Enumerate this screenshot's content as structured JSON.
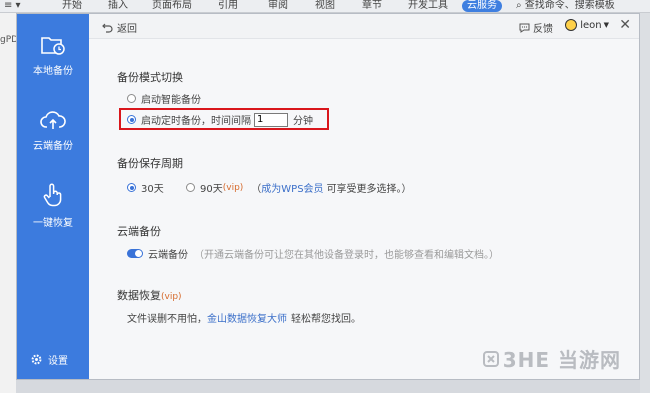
{
  "ribbon": {
    "items": [
      "开始",
      "插入",
      "页面布局",
      "引用",
      "审阅",
      "视图",
      "章节",
      "开发工具",
      "云服务",
      "查找命令、搜索模板"
    ],
    "left_fragment": "gPD"
  },
  "header": {
    "back_label": "返回",
    "feedback_label": "反馈",
    "user_name": "leon",
    "close_glyph": "✕"
  },
  "sidebar": {
    "items": [
      {
        "label": "本地备份",
        "icon": "folder-clock-icon"
      },
      {
        "label": "云端备份",
        "icon": "cloud-upload-icon"
      },
      {
        "label": "一键恢复",
        "icon": "hand-tap-icon"
      }
    ],
    "settings_label": "设置"
  },
  "backup_mode": {
    "title": "备份模式切换",
    "option_smart": "启动智能备份",
    "option_timed": "启动定时备份，时间间隔",
    "interval_value": "1",
    "interval_unit": "分钟",
    "selected": "timed"
  },
  "retention": {
    "title": "备份保存周期",
    "option_30": "30天",
    "option_90": "90天",
    "vip_tag": "(vip)",
    "note_open": "（",
    "note_link": "成为WPS会员",
    "note_rest": "可享受更多选择。）",
    "selected": "30"
  },
  "cloud": {
    "title": "云端备份",
    "toggle_label": "云端备份",
    "toggle_on": true,
    "description": "（开通云端备份可让您在其他设备登录时，也能够查看和编辑文档。）"
  },
  "recovery": {
    "title": "数据恢复",
    "vip_tag": "(vip)",
    "text_before": "文件误删不用怕，",
    "link": "金山数据恢复大师",
    "text_after": "轻松帮您找回。"
  },
  "watermark": {
    "text": "3HE 当游网"
  },
  "colors": {
    "sidebar": "#3c7bde",
    "accent": "#3a73d8",
    "highlight": "#d9161c",
    "vip": "#d66b2d",
    "link": "#3b6fc9"
  }
}
